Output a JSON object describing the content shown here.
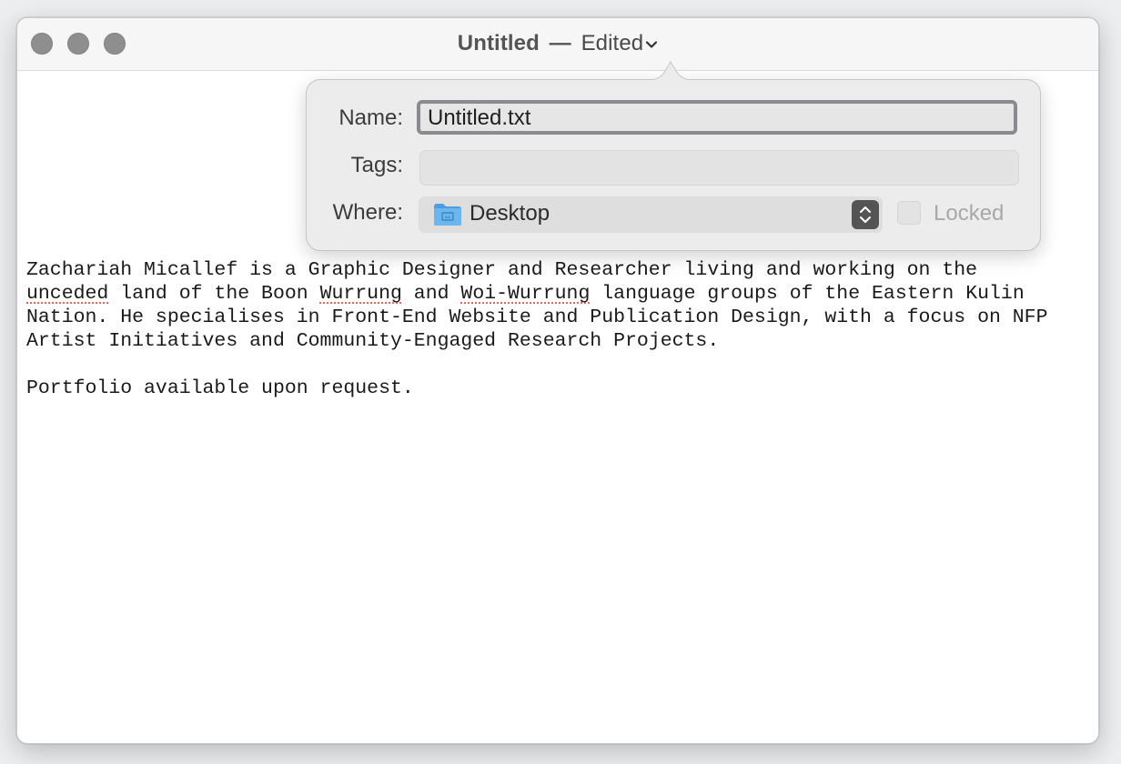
{
  "window": {
    "title": "Untitled",
    "separator": "—",
    "status": "Edited"
  },
  "save_popover": {
    "name_label": "Name:",
    "name_value": "Untitled.txt",
    "tags_label": "Tags:",
    "tags_value": "",
    "where_label": "Where:",
    "where_value": "Desktop",
    "locked_label": "Locked",
    "locked_checked": false
  },
  "document": {
    "line1": "Zachariah Micallef is a Graphic Designer and Researcher living and working on the",
    "line2_pre": " land of the Boon ",
    "line2_word1": "unceded",
    "line2_word2": "Wurrung",
    "line2_mid": " and ",
    "line2_word3": "Woi-Wurrung",
    "line2_post": " language groups of the Eastern Kulin",
    "line3": "Nation. He specialises in Front-End Website and Publication Design, with a focus on NFP",
    "line4": "Artist Initiatives and Community-Engaged Research Projects.",
    "line5": "",
    "line6": "Portfolio available upon request."
  },
  "colors": {
    "spellcheck_underline": "#e2675f",
    "folder_blue": "#5aa9e6"
  },
  "icons": {
    "close": "close-button-icon",
    "minimize": "minimize-button-icon",
    "zoom": "zoom-button-icon",
    "title_menu": "chevron-down-icon",
    "folder": "folder-icon",
    "stepper": "up-down-chevron-icon"
  }
}
